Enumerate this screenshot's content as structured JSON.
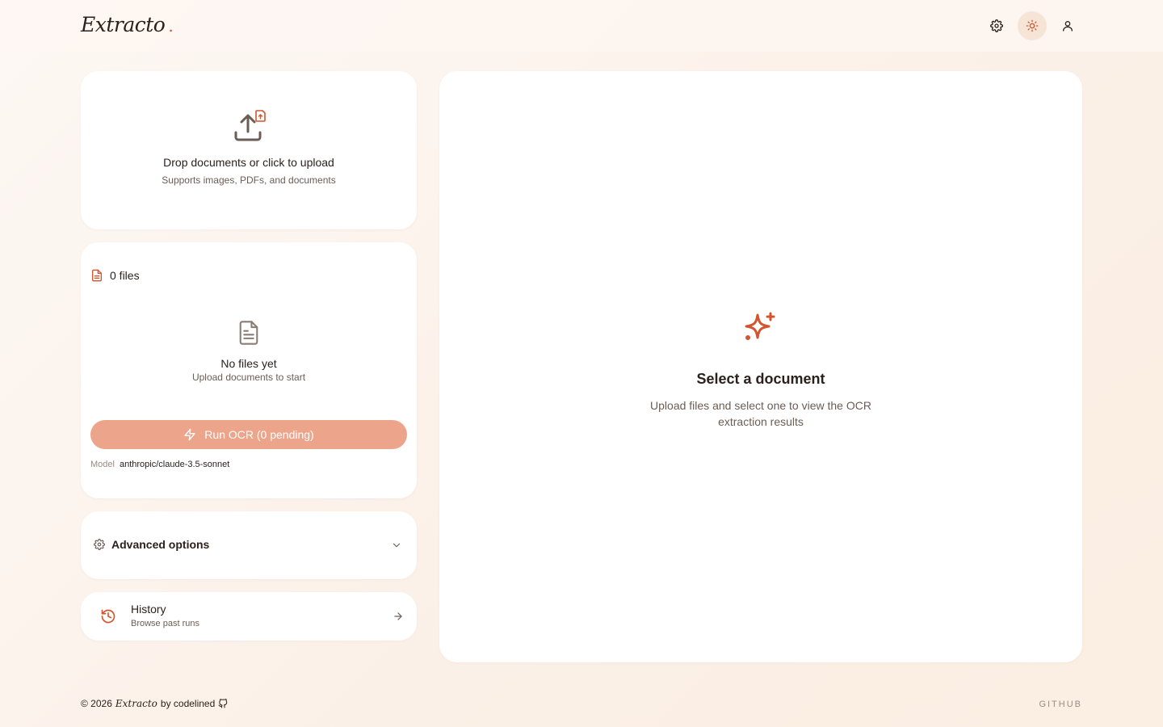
{
  "header": {
    "logo_text": "Extracto",
    "logo_dot": ".",
    "icons": [
      "gear-icon",
      "sun-icon",
      "user-icon"
    ]
  },
  "upload": {
    "title": "Drop documents or click to upload",
    "subtitle": "Supports images, PDFs, and documents"
  },
  "files": {
    "count_label": "0 files",
    "empty_title": "No files yet",
    "empty_subtitle": "Upload documents to start",
    "run_button": "Run OCR (0 pending)",
    "model_label": "Model",
    "model_value": "anthropic/claude-3.5-sonnet"
  },
  "advanced": {
    "label": "Advanced options"
  },
  "history": {
    "title": "History",
    "subtitle": "Browse past runs"
  },
  "main": {
    "title": "Select a document",
    "subtitle": "Upload files and select one to view the OCR extraction results"
  },
  "footer": {
    "copyright": "© 2026",
    "brand": "Extracto",
    "by": "by codelined",
    "github": "GITHUB"
  },
  "colors": {
    "accent": "#d2552f",
    "button_disabled": "#eca58b",
    "background": "#fbf1e8"
  }
}
